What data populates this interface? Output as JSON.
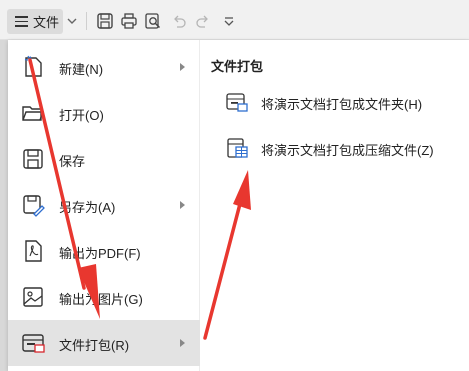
{
  "toolbar": {
    "file_label": "文件",
    "icons": [
      "menu-icon",
      "chevron-down-icon",
      "save-icon",
      "print-icon",
      "print-preview-icon",
      "undo-icon",
      "redo-icon",
      "customize-icon"
    ]
  },
  "menu": {
    "items": [
      {
        "label": "新建(N)",
        "icon": "new-doc-icon",
        "has_submenu": true
      },
      {
        "label": "打开(O)",
        "icon": "folder-open-icon",
        "has_submenu": false
      },
      {
        "label": "保存",
        "icon": "save-icon",
        "has_submenu": false
      },
      {
        "label": "另存为(A)",
        "icon": "save-as-icon",
        "has_submenu": true
      },
      {
        "label": "输出为PDF(F)",
        "icon": "export-pdf-icon",
        "has_submenu": false
      },
      {
        "label": "输出为图片(G)",
        "icon": "export-image-icon",
        "has_submenu": false
      },
      {
        "label": "文件打包(R)",
        "icon": "file-package-icon",
        "has_submenu": true,
        "active": true
      }
    ]
  },
  "submenu": {
    "title": "文件打包",
    "items": [
      {
        "label": "将演示文档打包成文件夹(H)",
        "icon": "package-folder-icon"
      },
      {
        "label": "将演示文档打包成压缩文件(Z)",
        "icon": "package-zip-icon"
      }
    ]
  },
  "colors": {
    "annotation_arrow": "#e8372f",
    "active_item_bg": "#e3e3e3",
    "accent_red": "#d7282f",
    "accent_blue": "#2f6fd0"
  }
}
